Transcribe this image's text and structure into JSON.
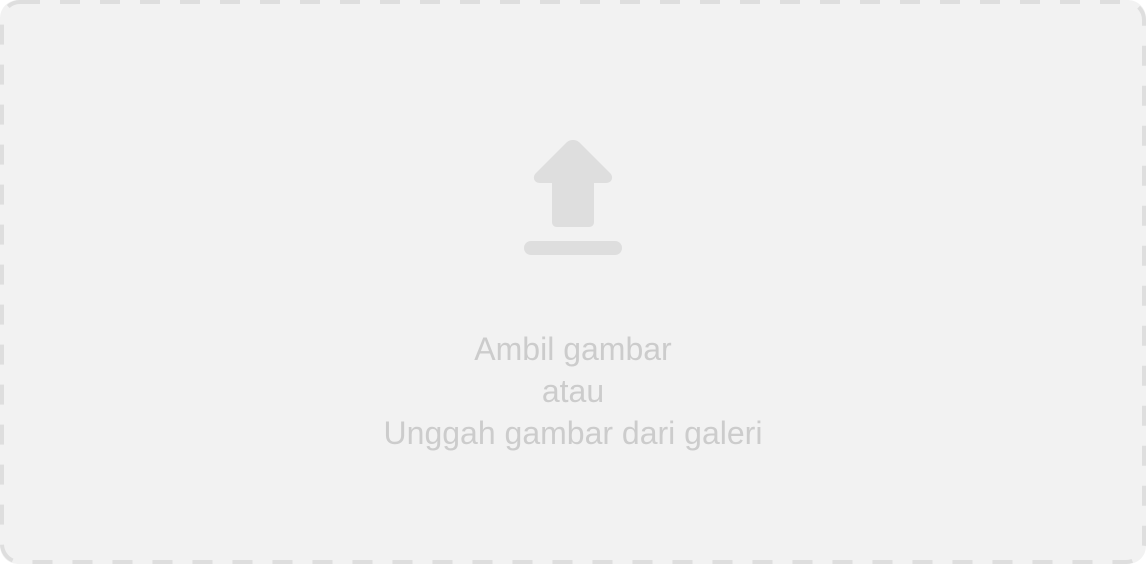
{
  "upload": {
    "line1": "Ambil gambar",
    "line2": "atau",
    "line3": "Unggah gambar dari galeri",
    "icon": "upload-arrow-icon"
  },
  "colors": {
    "background": "#f2f2f2",
    "border": "#dedede",
    "icon": "#dedede",
    "text": "#cccccc"
  }
}
